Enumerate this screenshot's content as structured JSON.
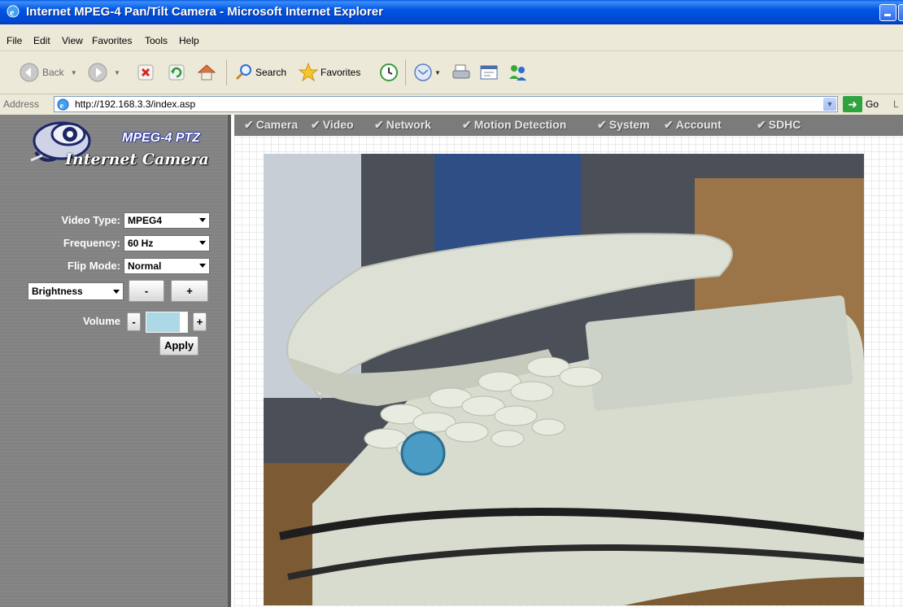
{
  "window": {
    "title": "Internet MPEG-4 Pan/Tilt Camera - Microsoft Internet Explorer"
  },
  "menu": {
    "items": [
      "File",
      "Edit",
      "View",
      "Favorites",
      "Tools",
      "Help"
    ]
  },
  "toolbar": {
    "back_label": "Back",
    "search_label": "Search",
    "favorites_label": "Favorites"
  },
  "address": {
    "label": "Address",
    "url": "http://192.168.3.3/index.asp",
    "go_label": "Go",
    "links_label": "L"
  },
  "logo": {
    "product": "MPEG-4 PTZ",
    "name": "Internet Camera"
  },
  "nav": {
    "items": [
      "Camera",
      "Video",
      "Network",
      "Motion Detection",
      "System",
      "Account",
      "SDHC"
    ]
  },
  "controls": {
    "video_type_label": "Video Type:",
    "video_type_value": "MPEG4",
    "frequency_label": "Frequency:",
    "frequency_value": "60 Hz",
    "flip_mode_label": "Flip Mode:",
    "flip_mode_value": "Normal",
    "adjust_select_value": "Brightness",
    "minus_label": "-",
    "plus_label": "+",
    "volume_label": "Volume",
    "volume_minus": "-",
    "volume_plus": "+",
    "volume_level": 0.8,
    "apply_label": "Apply"
  },
  "colors": {
    "titlebar": "#0055e5",
    "panel_gray": "#808080",
    "volume_fill": "#add8e6",
    "logo_accent": "#2a36a0"
  },
  "icons": [
    "ie-icon",
    "back-arrow-icon",
    "forward-arrow-icon",
    "stop-icon",
    "refresh-icon",
    "home-icon",
    "search-icon",
    "favorites-star-icon",
    "history-icon",
    "mail-icon",
    "print-icon",
    "edit-icon",
    "messenger-icon",
    "page-icon",
    "go-arrow-icon",
    "eye-logo-icon"
  ]
}
